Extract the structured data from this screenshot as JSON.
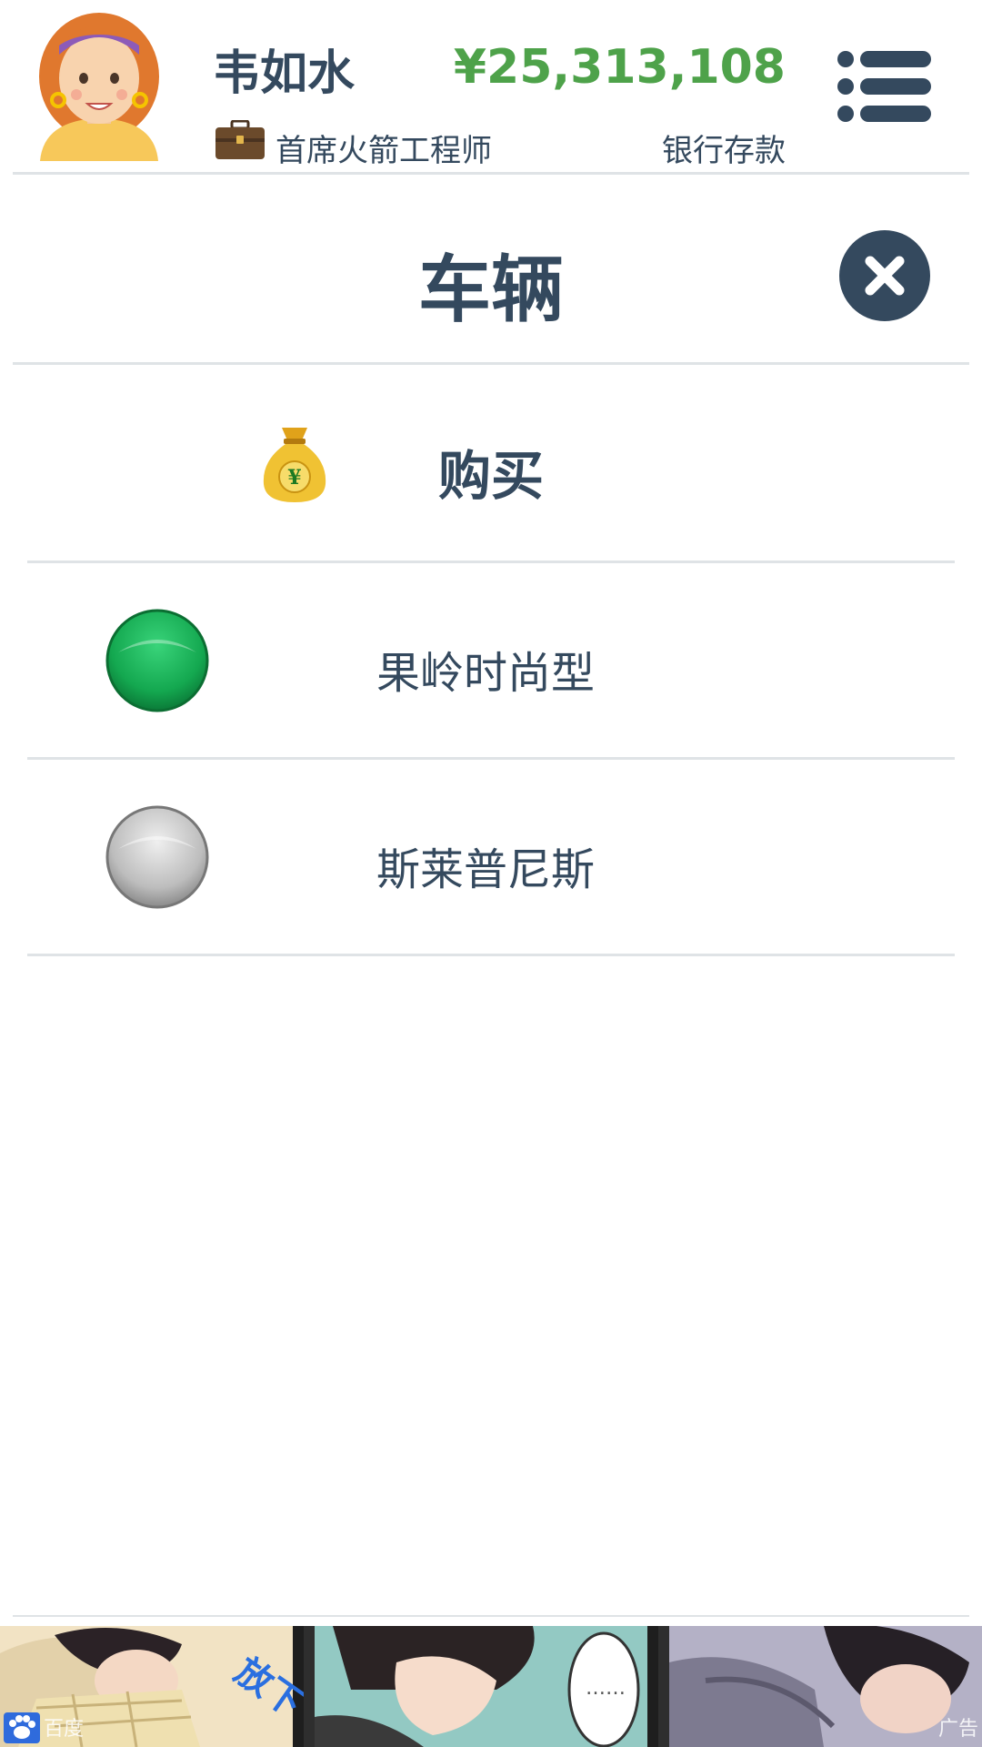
{
  "header": {
    "player_name": "韦如水",
    "job_title": "首席火箭工程师",
    "money": "¥25,313,108",
    "money_label": "银行存款",
    "job_icon": "briefcase-icon",
    "menu_icon": "list-menu-icon"
  },
  "page": {
    "title": "车辆",
    "close_icon": "close-icon"
  },
  "buy": {
    "label": "购买",
    "icon": "money-bag-icon"
  },
  "vehicles": [
    {
      "name": "果岭时尚型",
      "status_color": "#1cb35b",
      "status": "selected"
    },
    {
      "name": "斯莱普尼斯",
      "status_color": "#b8b8b8",
      "status": "unselected"
    }
  ],
  "ad": {
    "source_label": "百度",
    "badge": "广告",
    "panel_text": "放下",
    "speech_bubble": "……"
  },
  "colors": {
    "text": "#34495e",
    "money": "#4ea24a",
    "divider": "#dfe3e6",
    "accent_dark": "#34495e"
  }
}
